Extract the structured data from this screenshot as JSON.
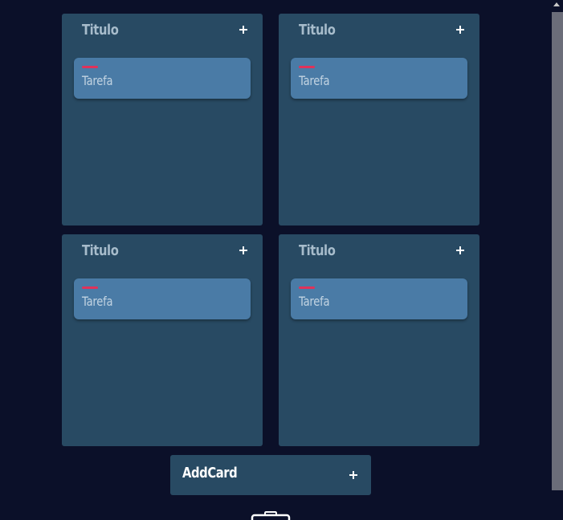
{
  "columns": [
    {
      "title": "Titulo",
      "add_symbol": "+",
      "tasks": [
        {
          "label": "Tarefa"
        }
      ]
    },
    {
      "title": "Titulo",
      "add_symbol": "+",
      "tasks": [
        {
          "label": "Tarefa"
        }
      ]
    },
    {
      "title": "Titulo",
      "add_symbol": "+",
      "tasks": [
        {
          "label": "Tarefa"
        }
      ]
    },
    {
      "title": "Titulo",
      "add_symbol": "+",
      "tasks": [
        {
          "label": "Tarefa"
        }
      ]
    }
  ],
  "add_card": {
    "label": "AddCard"
  },
  "colors": {
    "background": "#0b1029",
    "column": "#284a63",
    "task": "#4a7ba6",
    "task_tag": "#e0325a",
    "title_text": "#a7bccb"
  },
  "icons": {
    "column_add": "plus-icon",
    "add_card": "plus-icon",
    "bottom": "briefcase-icon"
  }
}
